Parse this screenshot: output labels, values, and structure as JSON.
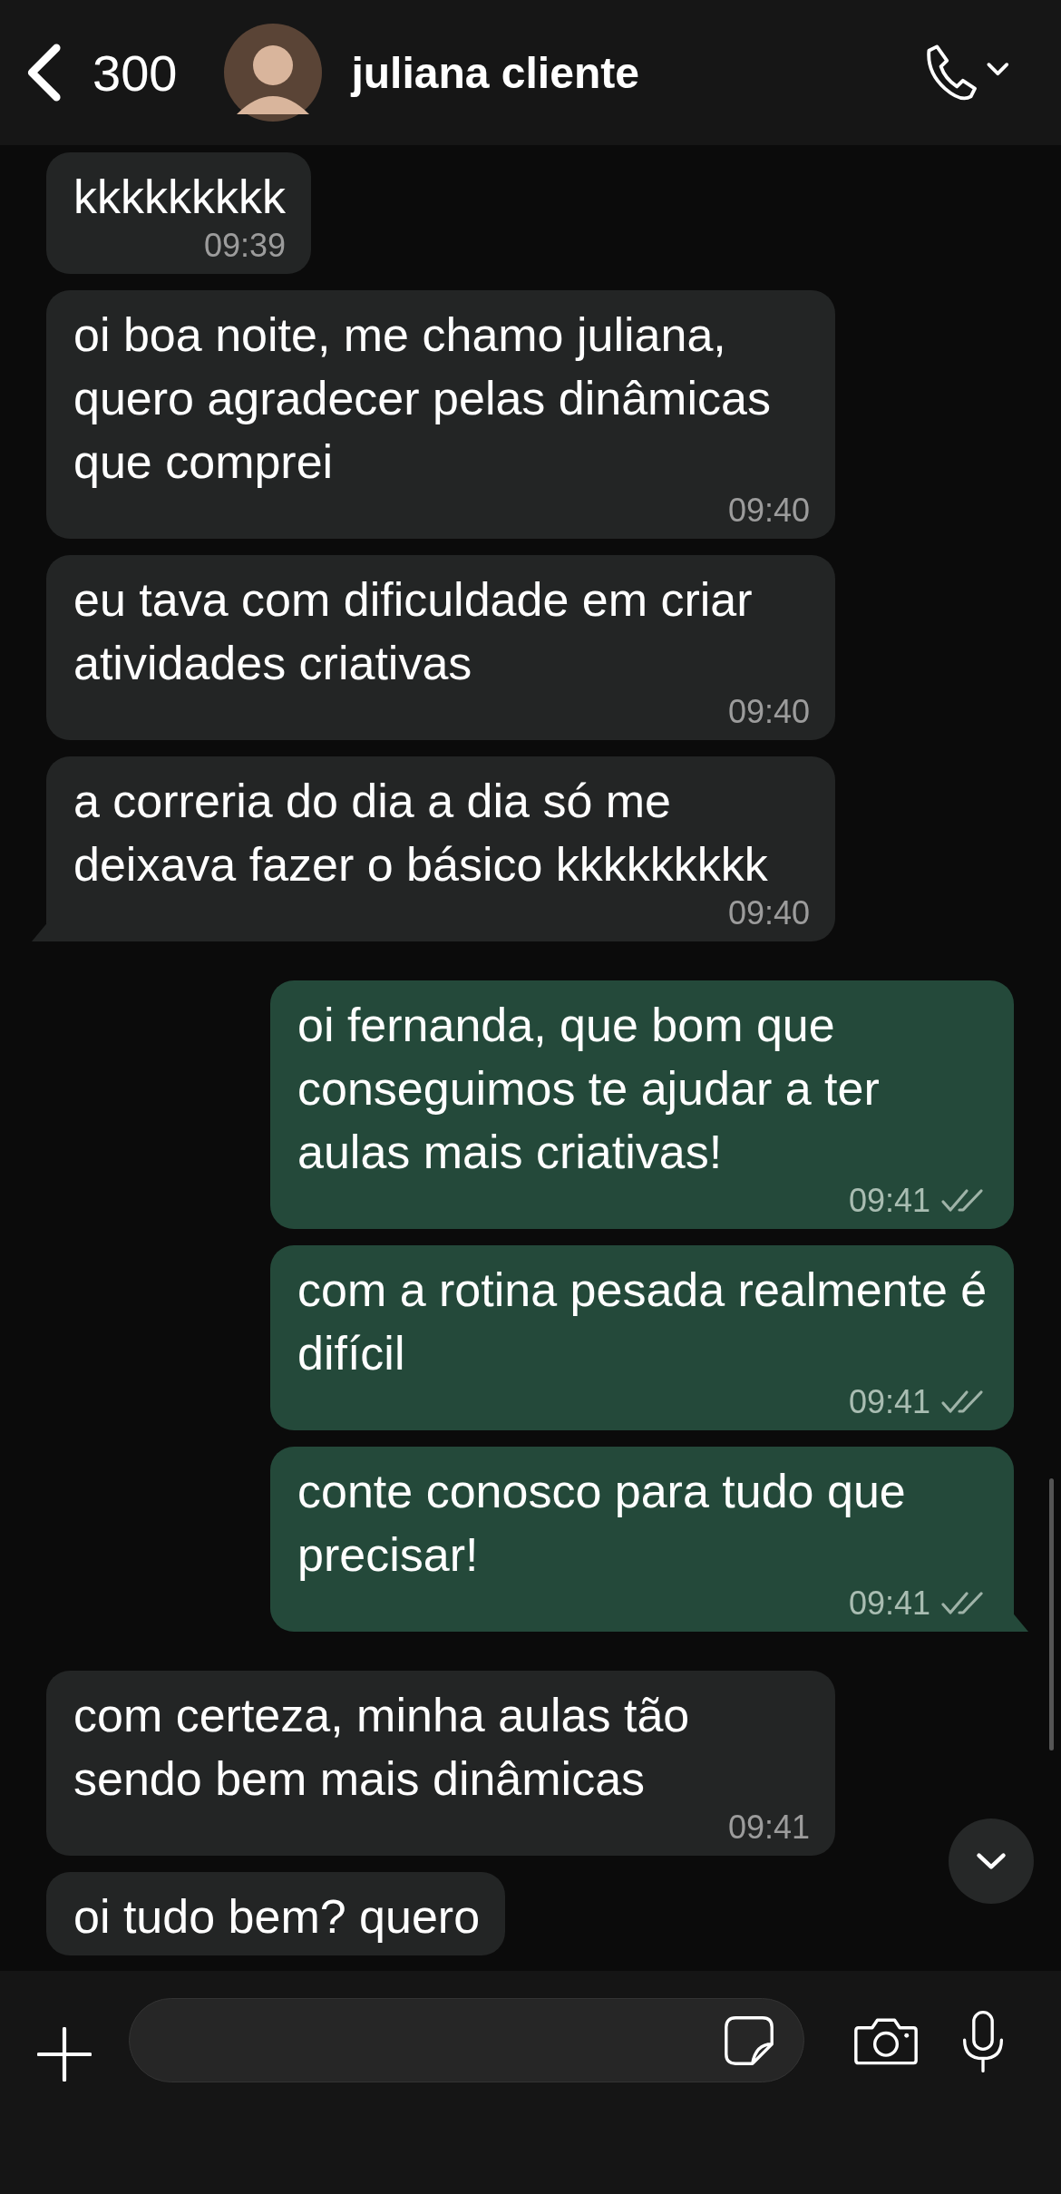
{
  "header": {
    "back_count": "300",
    "contact_name": "juliana cliente"
  },
  "messages": [
    {
      "kind": "incoming",
      "text": "kkkkkkkkk",
      "time": "09:39",
      "tail": false
    },
    {
      "kind": "incoming",
      "text": "oi boa noite, me chamo juliana, quero agradecer pelas dinâmicas que comprei",
      "time": "09:40",
      "tail": false
    },
    {
      "kind": "incoming",
      "text": "eu tava com dificuldade em criar atividades criativas",
      "time": "09:40",
      "tail": false
    },
    {
      "kind": "incoming",
      "text": "a correria do dia a dia só me deixava fazer o básico kkkkkkkkk",
      "time": "09:40",
      "tail": true
    },
    {
      "kind": "outgoing",
      "text": "oi fernanda, que bom que conseguimos te ajudar a ter aulas mais criativas!",
      "time": "09:41",
      "read": false,
      "tail": false
    },
    {
      "kind": "outgoing",
      "text": "com a rotina pesada realmente é difícil",
      "time": "09:41",
      "read": false,
      "tail": false
    },
    {
      "kind": "outgoing",
      "text": "conte conosco para tudo que precisar!",
      "time": "09:41",
      "read": false,
      "tail": true
    },
    {
      "kind": "incoming",
      "text": "com certeza, minha aulas tão sendo bem mais dinâmicas",
      "time": "09:41",
      "tail": false
    },
    {
      "kind": "incoming",
      "text": "oi tudo bem? quero",
      "tail": false
    }
  ]
}
